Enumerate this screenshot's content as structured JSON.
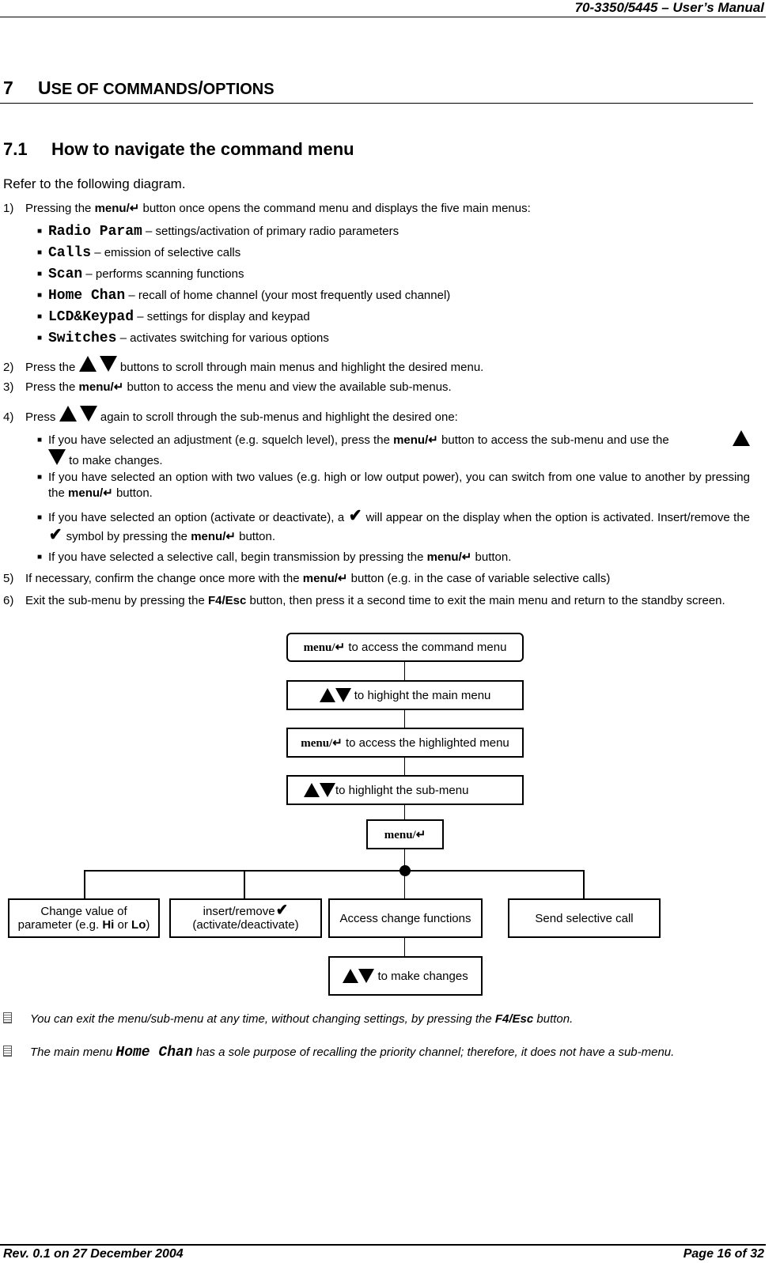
{
  "header": {
    "title": "70-3350/5445 – User’s Manual"
  },
  "footer": {
    "revision": "Rev. 0.1 on 27 December 2004",
    "page": "Page 16 of 32"
  },
  "section": {
    "number": "7",
    "title_first": "U",
    "title_rest": "SE OF COMMANDS",
    "title_sep": "/",
    "title_rest2": "OPTIONS"
  },
  "subsection": {
    "number": "7.1",
    "title": "How to navigate the command menu"
  },
  "intro": "Refer to the following diagram.",
  "menu_key": "menu/↵",
  "esc_key": "F4/Esc",
  "steps": [
    {
      "n": "1)",
      "pre": "Pressing the",
      "post": "button once opens the command menu and displays the five main menus:"
    },
    {
      "n": "2)",
      "pre": "Press the",
      "post": "buttons to scroll through main menus and highlight the desired menu."
    },
    {
      "n": "3)",
      "pre": "Press the",
      "post": "button to access the menu and view the available sub-menus."
    },
    {
      "n": "4)",
      "pre": "Press",
      "post": "again to scroll through the sub-menus and highlight the desired one:"
    },
    {
      "n": "5)",
      "pre": "If necessary, confirm the change once more with the",
      "post": "button (e.g. in the case of variable selective calls)"
    },
    {
      "n": "6)",
      "pre": "Exit the sub-menu by pressing the",
      "post": "button, then press it a second time to exit the main menu and return to the standby screen."
    }
  ],
  "main_menus": [
    {
      "name": "Radio Param",
      "desc": "– settings/activation of primary radio parameters"
    },
    {
      "name": "Calls",
      "desc": "– emission of selective calls"
    },
    {
      "name": "Scan",
      "desc": "– performs scanning functions"
    },
    {
      "name": "Home Chan",
      "desc": "– recall of home channel (your most frequently used channel)"
    },
    {
      "name": "LCD&Keypad",
      "desc": "– settings for display and keypad"
    },
    {
      "name": "Switches",
      "desc": "– activates switching for various options"
    }
  ],
  "sub_bullets": [
    {
      "pre": "If you have selected an adjustment (e.g. squelch level), press the",
      "mid": "button to access the sub-menu and use the",
      "post": "to make changes."
    },
    {
      "pre": "If you have selected an option with two values (e.g. high or low output power), you can switch from one value to another by pressing the",
      "post": "button."
    },
    {
      "pre": "If you have selected an option (activate or deactivate), a",
      "mid": "will appear on the display when the option is activated. Insert/remove the",
      "mid2": "symbol by pressing the",
      "post": "button."
    },
    {
      "pre": "If you have selected a selective call, begin transmission by pressing the",
      "post": "button."
    }
  ],
  "diagram": {
    "box1": "to access the command menu",
    "box2": "to highight the main menu",
    "box3": "to access the highlighted menu",
    "box4": "to highlight the sub-menu",
    "box5": "",
    "branch1_line1": "Change value of",
    "branch1_line2_pre": "parameter (e.g.",
    "branch1_hi": "Hi",
    "branch1_or": "or",
    "branch1_lo": "Lo",
    "branch1_close": ")",
    "branch2_line1": "insert/remove",
    "branch2_line2": "(activate/deactivate)",
    "branch3": "Access change functions",
    "branch4": "Send selective call",
    "box_final": "to make changes"
  },
  "notes": [
    {
      "text": "You can exit the menu/sub-menu at any time, without changing settings, by pressing the",
      "post": "button."
    },
    {
      "pre": "The main menu",
      "mono": "Home Chan",
      "post": "has a sole purpose of recalling the priority channel; therefore, it does not have a sub-menu."
    }
  ],
  "icons": {
    "up": "up-triangle-icon",
    "down": "down-triangle-icon",
    "check": "checkmark-icon",
    "note": "note-icon"
  }
}
